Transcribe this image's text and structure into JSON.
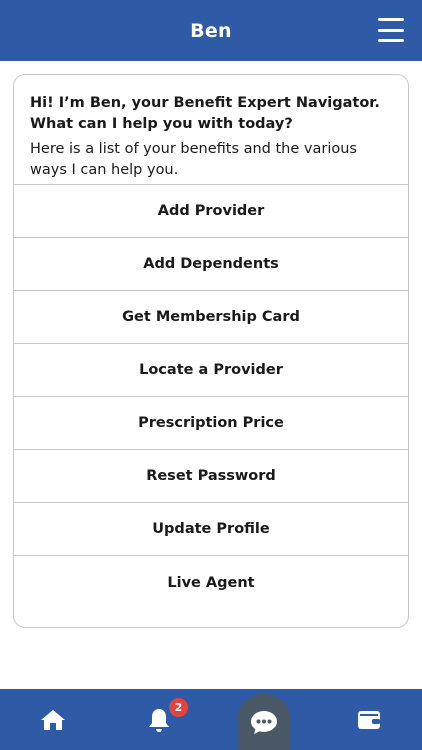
{
  "header": {
    "title": "Ben"
  },
  "chat": {
    "greeting": "Hi! I’m Ben, your Benefit Expert Navigator. What can I help you with today?",
    "subtext": "Here is a list of your benefits and the various ways I can help you.",
    "options": [
      "Add Provider",
      "Add Dependents",
      "Get Membership Card",
      "Locate a Provider",
      "Prescription Price",
      "Reset Password",
      "Update Profile",
      "Live Agent"
    ]
  },
  "bottom_nav": {
    "items": [
      "home-icon",
      "bell-icon",
      "chat-icon",
      "wallet-icon"
    ],
    "notification_count": "2",
    "active": "chat"
  },
  "colors": {
    "brand": "#2f5aa6",
    "active_tab": "#4b5866",
    "badge": "#e0443d"
  }
}
